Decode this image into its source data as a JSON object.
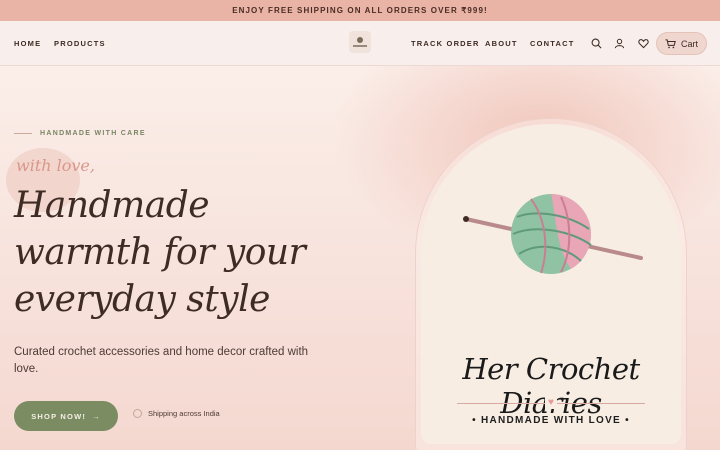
{
  "announcement": "ENJOY FREE SHIPPING ON ALL ORDERS OVER ₹999!",
  "nav": {
    "home": "HOME",
    "products": "PRODUCTS",
    "track_order": "TRACK ORDER",
    "about": "ABOUT",
    "contact": "CONTACT",
    "cart": "Cart"
  },
  "icons": {
    "search": "search-icon",
    "account": "user-icon",
    "wishlist": "heart-icon",
    "cart": "cart-icon"
  },
  "hero": {
    "eyebrow": "HANDMADE WITH CARE",
    "script": "with love,",
    "headline": "Handmade warmth for your everyday style",
    "subtext": "Curated crochet accessories and home decor crafted with love.",
    "cta": "SHOP NOW!",
    "cta_arrow": "→",
    "shipping": "Shipping across India"
  },
  "brand": {
    "name": "Her Crochet Diaries",
    "tagline": "• HANDMADE WITH LOVE •",
    "heart": "♥"
  },
  "colors": {
    "announcement_bg": "#e9b4a6",
    "accent_green": "#7c8c62",
    "yarn_green": "#8fc3a3",
    "yarn_pink": "#e8a6b6",
    "hook": "#b98a8a"
  }
}
